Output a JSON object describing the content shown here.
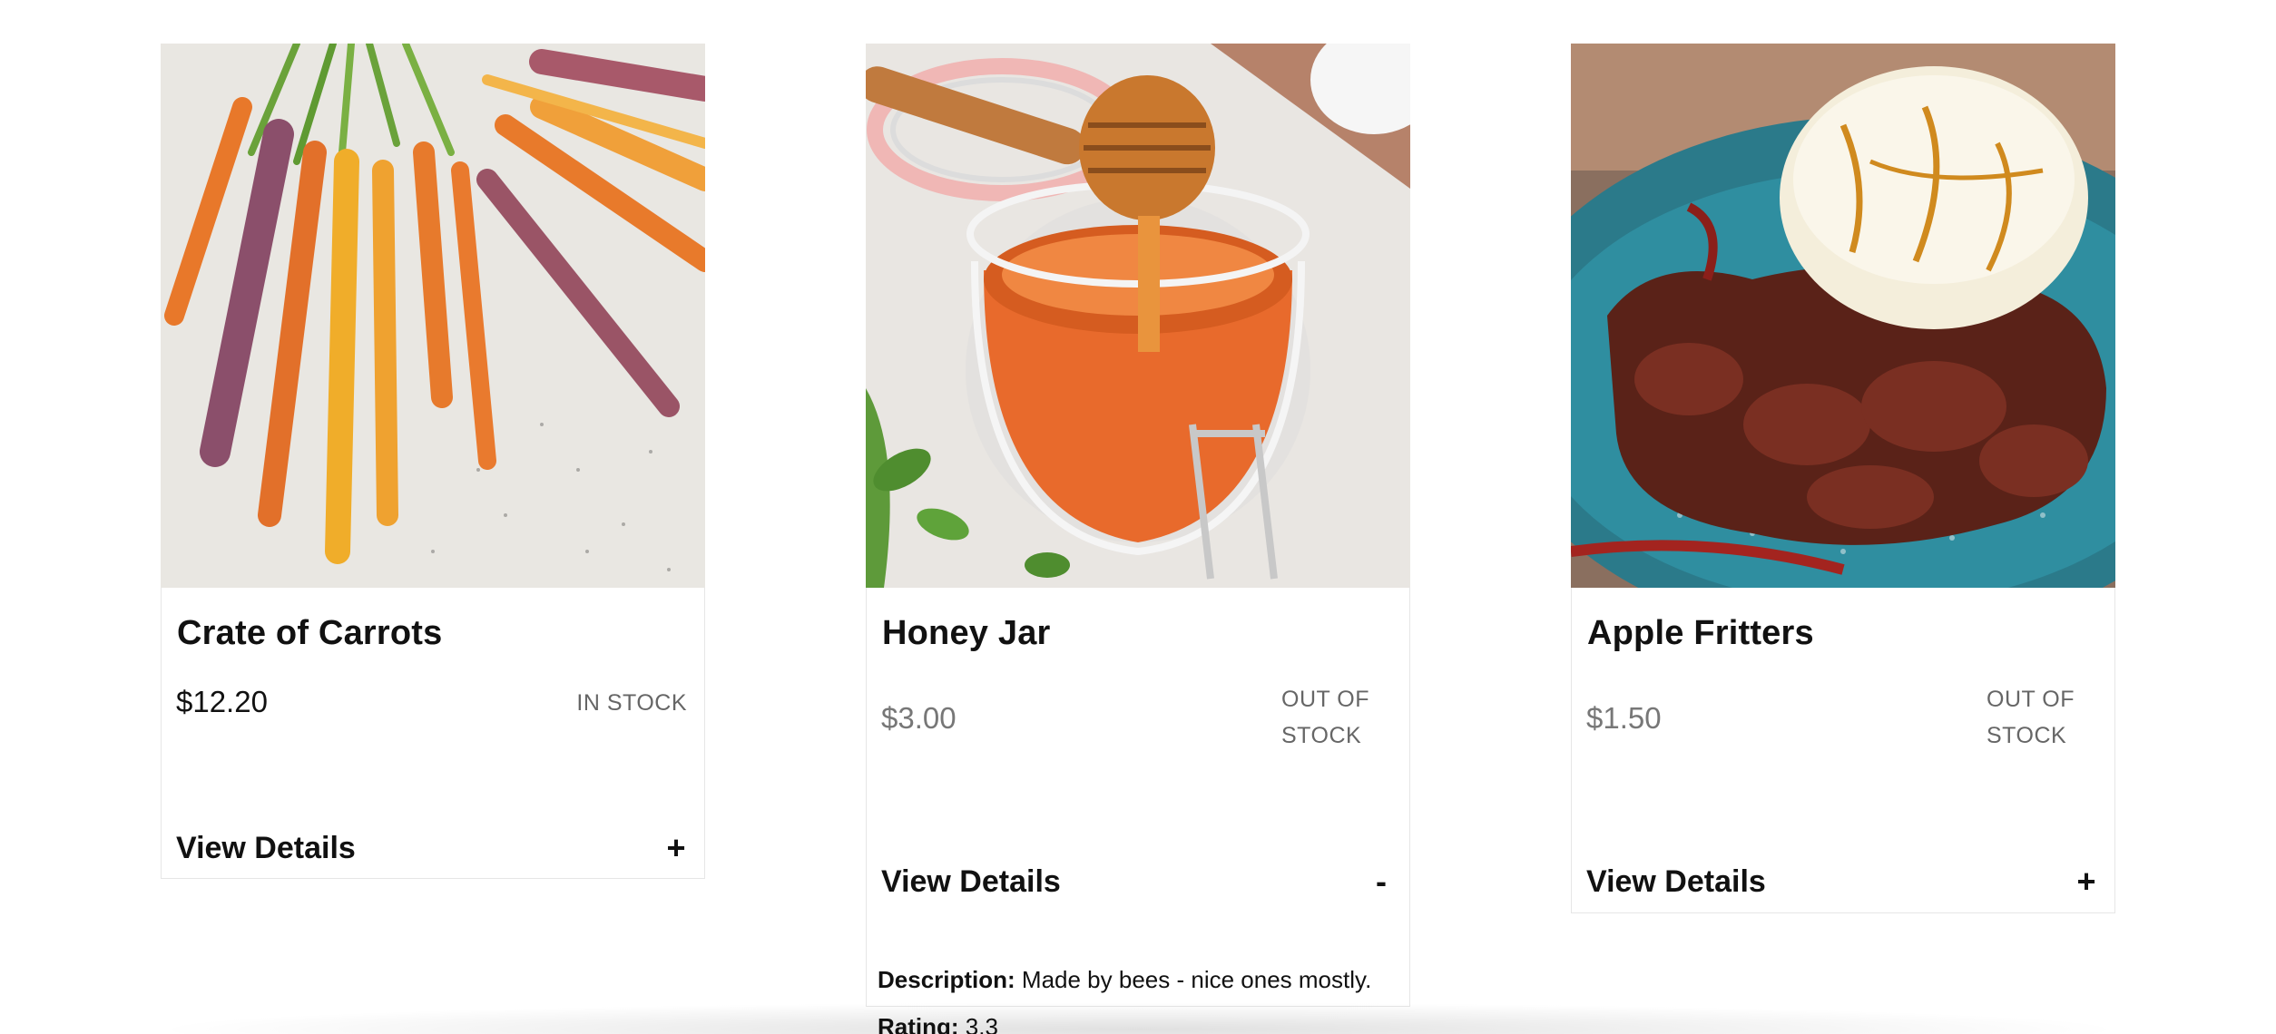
{
  "products": [
    {
      "name": "Crate of Carrots",
      "price": "$12.20",
      "stock": "IN STOCK",
      "details_label": "View Details",
      "toggle": "+"
    },
    {
      "name": "Honey Jar",
      "price": "$3.00",
      "stock": "OUT OF STOCK",
      "details_label": "View Details",
      "toggle": "-",
      "description_label": "Description:",
      "description": "Made by bees - nice ones mostly.",
      "rating_label": "Rating:",
      "rating": "3.3"
    },
    {
      "name": "Apple Fritters",
      "price": "$1.50",
      "stock": "OUT OF STOCK",
      "details_label": "View Details",
      "toggle": "+"
    }
  ],
  "colors": {
    "text": "#111111",
    "muted": "#777777",
    "border": "#e6e6e6"
  }
}
